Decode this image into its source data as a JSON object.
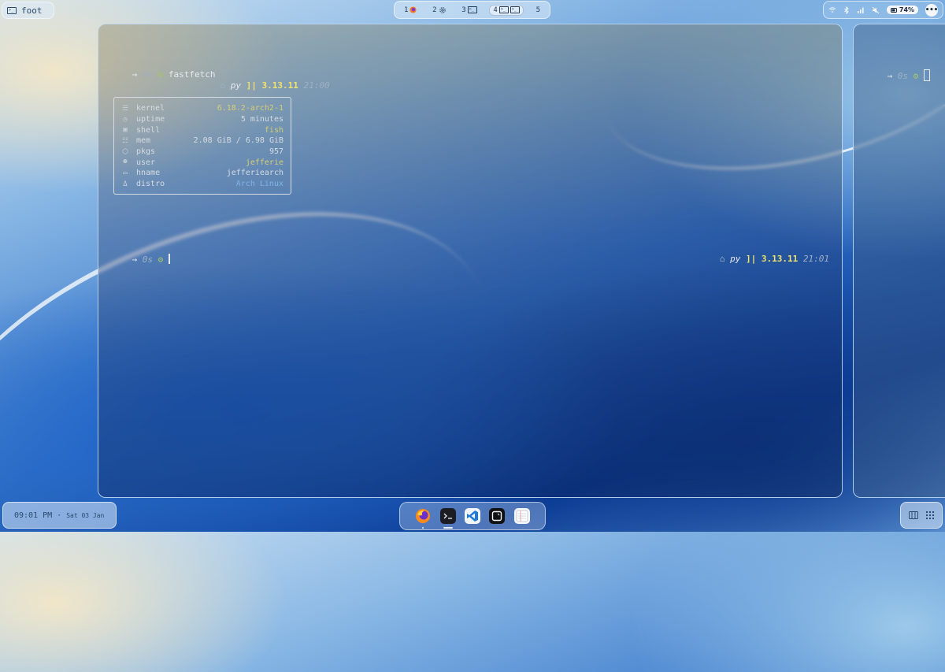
{
  "topbar": {
    "window_title": "foot",
    "workspaces": [
      {
        "number": "1",
        "icons": [
          "firefox-icon"
        ]
      },
      {
        "number": "2",
        "icons": [
          "settings-gear-icon"
        ]
      },
      {
        "number": "3",
        "icons": [
          "terminal-icon"
        ]
      },
      {
        "number": "4",
        "icons": [
          "terminal-icon",
          "terminal-icon"
        ],
        "active": true
      },
      {
        "number": "5",
        "icons": []
      }
    ],
    "tray": {
      "icons": [
        "wifi-icon",
        "bluetooth-icon",
        "signal-icon",
        "mute-icon"
      ],
      "battery": "74%",
      "more": "•••"
    }
  },
  "terminal": {
    "prompt_arrow": "→",
    "prompt_time": "0s",
    "prompt_symbol": "⚙",
    "command1": "fastfetch",
    "right_prompt_home": "⌂",
    "right_prompt_lang": "py",
    "right_prompt_sep": "]|",
    "right_prompt_version": "3.13.11",
    "right_prompt_clock1": "21:00",
    "right_prompt_clock2": "21:01",
    "fastfetch": [
      {
        "icon": "☰",
        "key": "kernel",
        "value": "6.18.2-arch2-1",
        "color": "#d5cf73"
      },
      {
        "icon": "◷",
        "key": "uptime",
        "value": "5 minutes",
        "color": "#d6dbe2"
      },
      {
        "icon": "▣",
        "key": "shell",
        "value": "fish",
        "color": "#d5cf73"
      },
      {
        "icon": "☷",
        "key": "mem",
        "value": "2.08 GiB / 6.98 GiB",
        "color": "#d6dbe2"
      },
      {
        "icon": "⬡",
        "key": "pkgs",
        "value": "957",
        "color": "#d6dbe2"
      },
      {
        "icon": "☻",
        "key": "user",
        "value": "jefferie",
        "color": "#d5cf73"
      },
      {
        "icon": "▭",
        "key": "hname",
        "value": "jefferiearch",
        "color": "#d6dbe2"
      },
      {
        "icon": "Δ",
        "key": "distro",
        "value": "Arch Linux",
        "color": "#7fb6ea"
      }
    ]
  },
  "side_terminal": {
    "prompt_arrow": "→",
    "prompt_time": "0s",
    "prompt_symbol": "⚙"
  },
  "bottombar": {
    "clock": "09:01 PM",
    "separator": "·",
    "date": "Sat 03 Jan",
    "dock_apps": [
      "firefox",
      "terminal",
      "vscode",
      "editor",
      "notes"
    ],
    "view_icons": [
      "split-view-icon",
      "grid-view-icon"
    ]
  }
}
